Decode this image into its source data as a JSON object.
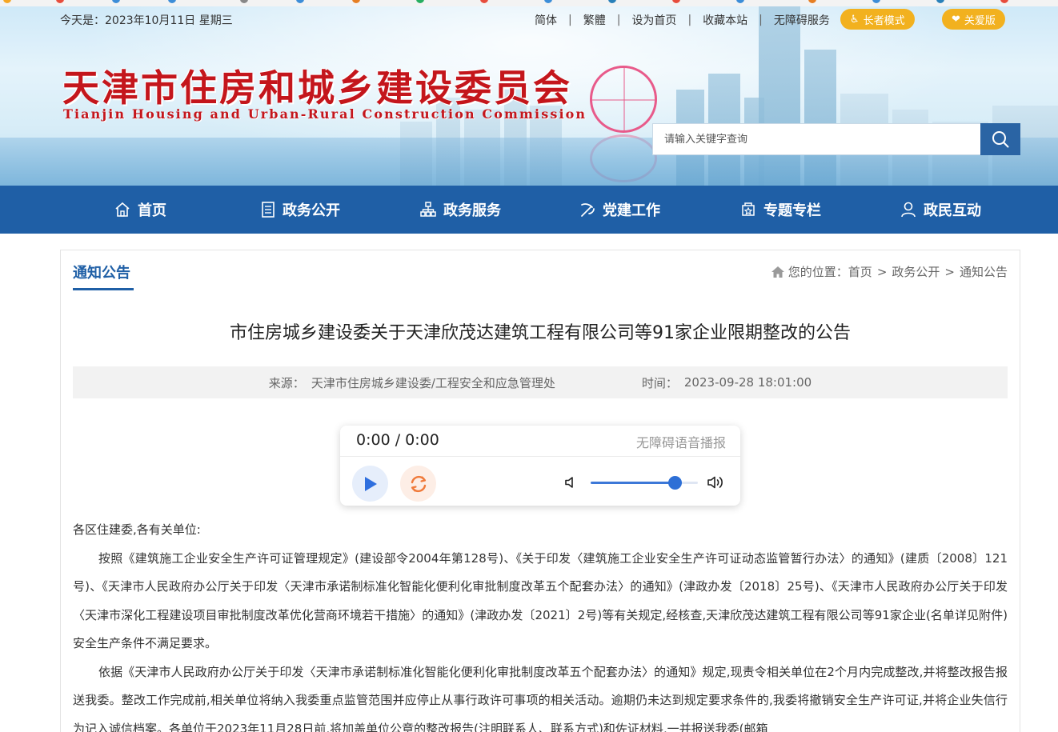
{
  "header": {
    "date": "今天是：2023年10月11日 星期三",
    "links": [
      "简体",
      "繁體",
      "设为首页",
      "收藏本站",
      "无障碍服务"
    ],
    "elder_mode": "长者模式",
    "care_mode": "关爱版",
    "logo_cn": "天津市住房和城乡建设委员会",
    "logo_en": "Tianjin Housing and Urban-Rural Construction Commission",
    "search_placeholder": "请输入关键字查询"
  },
  "nav": {
    "items": [
      "首页",
      "政务公开",
      "政务服务",
      "党建工作",
      "专题专栏",
      "政民互动"
    ]
  },
  "section": {
    "title": "通知公告",
    "breadcrumb_prefix": "您的位置：",
    "breadcrumb": [
      "首页",
      "政务公开",
      "通知公告"
    ]
  },
  "article": {
    "title": "市住房城乡建设委关于天津欣茂达建筑工程有限公司等91家企业限期整改的公告",
    "source_label": "来源：",
    "source": "天津市住房城乡建设委/工程安全和应急管理处",
    "time_label": "时间：",
    "time": "2023-09-28 18:01:00",
    "salutation": "各区住建委,各有关单位:",
    "para1": "按照《建筑施工企业安全生产许可证管理规定》(建设部令2004年第128号)、《关于印发〈建筑施工企业安全生产许可证动态监管暂行办法〉的通知》(建质〔2008〕121号)、《天津市人民政府办公厅关于印发〈天津市承诺制标准化智能化便利化审批制度改革五个配套办法〉的通知》(津政办发〔2018〕25号)、《天津市人民政府办公厅关于印发〈天津市深化工程建设项目审批制度改革优化营商环境若干措施〉的通知》(津政办发〔2021〕2号)等有关规定,经核查,天津欣茂达建筑工程有限公司等91家企业(名单详见附件)安全生产条件不满足要求。",
    "para2": "依据《天津市人民政府办公厅关于印发〈天津市承诺制标准化智能化便利化审批制度改革五个配套办法〉的通知》规定,现责令相关单位在2个月内完成整改,并将整改报告报送我委。整改工作完成前,相关单位将纳入我委重点监管范围并应停止从事行政许可事项的相关活动。逾期仍未达到规定要求条件的,我委将撤销安全生产许可证,并将企业失信行为记入诚信档案。各单位于2023年11月28日前,将加盖单位公章的整改报告(注明联系人、联系方式)和佐证材料,一并报送我委(邮箱"
  },
  "player": {
    "time": "0:00 / 0:00",
    "label": "无障碍语音播报",
    "volume": 0.78
  },
  "colors": {
    "brand_blue": "#1f5fa6",
    "logo_red": "#c4161c",
    "pill_yellow": "#f2b11f"
  }
}
